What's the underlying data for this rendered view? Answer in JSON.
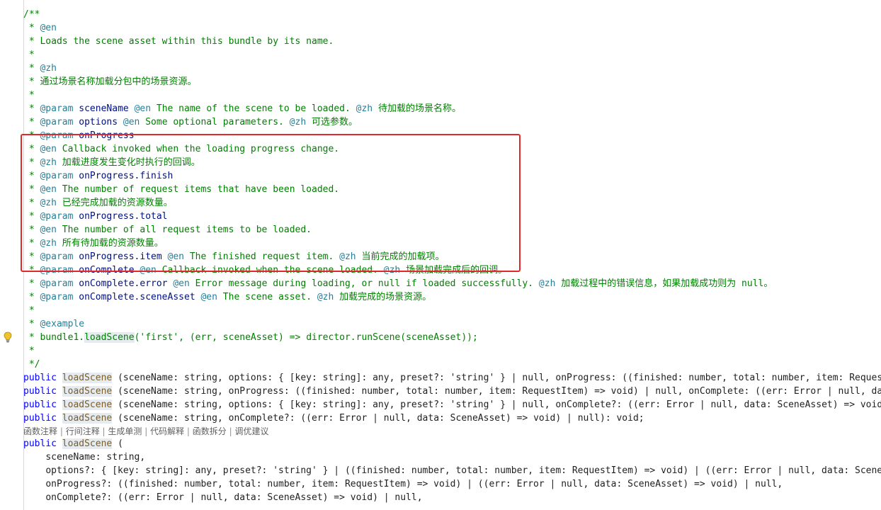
{
  "doc_comment": {
    "open": "/**",
    "en_tag": "@en",
    "en_desc": "Loads the scene asset within this bundle by its name.",
    "zh_tag": "@zh",
    "zh_desc": "通过场景名称加载分包中的场景资源。",
    "param_tag": "@param",
    "p_sceneName": "sceneName",
    "p_sceneName_en": "The name of the scene to be loaded.",
    "p_sceneName_zh": "待加载的场景名称。",
    "p_options": "options",
    "p_options_en": "Some optional parameters.",
    "p_options_zh": "可选参数。",
    "p_onProgress": "onProgress",
    "p_onProgress_en": "Callback invoked when the loading progress change.",
    "p_onProgress_zh": "加载进度发生变化时执行的回调。",
    "p_finish": "onProgress.finish",
    "p_finish_en": "The number of request items that have been loaded.",
    "p_finish_zh": "已经完成加载的资源数量。",
    "p_total": "onProgress.total",
    "p_total_en": "The number of all request items to be loaded.",
    "p_total_zh": "所有待加载的资源数量。",
    "p_item": "onProgress.item",
    "p_item_en": "The finished request item.",
    "p_item_zh": "当前完成的加载项。",
    "p_onComplete": "onComplete",
    "p_onComplete_en": "Callback invoked when the scene loaded.",
    "p_onComplete_zh": "场景加载完成后的回调。",
    "p_error": "onComplete.error",
    "p_error_en": "Error message during loading, or null if loaded successfully.",
    "p_error_zh": "加载过程中的错误信息，如果加载成功则为 null。",
    "p_sceneAsset": "onComplete.sceneAsset",
    "p_sceneAsset_en": "The scene asset.",
    "p_sceneAsset_zh": "加载完成的场景资源。",
    "example_tag": "@example",
    "example_code_pre": "bundle1.",
    "example_code_fn": "loadScene",
    "example_code_post": "('first', (err, sceneAsset) => director.runScene(sceneAsset));",
    "close": "*/"
  },
  "overloads": [
    "(sceneName: string, options: { [key: string]: any, preset?: 'string' } | null, onProgress: ((finished: number, total: number, item: RequestItem",
    "(sceneName: string, onProgress: ((finished: number, total: number, item: RequestItem) => void) | null, onComplete: ((err: Error | null, data",
    "(sceneName: string, options: { [key: string]: any, preset?: 'string' } | null, onComplete?: ((err: Error | null, data: SceneAsset) => void)",
    "(sceneName: string, onComplete?: ((err: Error | null, data: SceneAsset) => void) | null): void;"
  ],
  "keyword_public": "public",
  "fn_name": "loadScene",
  "codelens": [
    "函数注释",
    "行间注释",
    "生成单测",
    "代码解释",
    "函数拆分",
    "调优建议"
  ],
  "impl": {
    "open": "(",
    "l1": "sceneName: string,",
    "l2": "options?: { [key: string]: any, preset?: 'string' } | ((finished: number, total: number, item: RequestItem) => void) | ((err: Error | null, data: SceneAss",
    "l3": "onProgress?: ((finished: number, total: number, item: RequestItem) => void) | ((err: Error | null, data: SceneAsset) => void) | null,",
    "l4": "onComplete?: ((err: Error | null, data: SceneAsset) => void) | null,"
  },
  "colors": {
    "highlight_box": "#e0282d",
    "comment": "#008000",
    "keyword": "#0000ff",
    "function": "#795e26"
  },
  "icons": [
    "lightbulb-icon"
  ]
}
